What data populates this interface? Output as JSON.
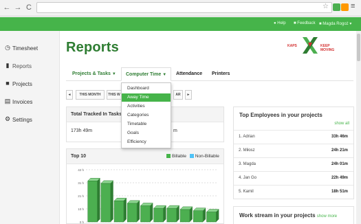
{
  "browser": {
    "back_icon": "back-arrow-icon",
    "forward_icon": "forward-arrow-icon",
    "reload_icon": "reload-icon"
  },
  "header": {
    "help": "Help",
    "feedback": "Feedback",
    "user": "Magda Rogoż"
  },
  "sidebar": {
    "items": [
      {
        "label": "Timesheet",
        "icon": "clock-icon"
      },
      {
        "label": "Reports",
        "icon": "bar-chart-icon"
      },
      {
        "label": "Projects",
        "icon": "briefcase-icon"
      },
      {
        "label": "Invoices",
        "icon": "document-icon"
      },
      {
        "label": "Settings",
        "icon": "gear-icon"
      }
    ]
  },
  "page": {
    "title": "Reports",
    "logo_left": "KAPS",
    "logo_right": "KEEP MOVING"
  },
  "tabs": [
    {
      "label": "Projects & Tasks"
    },
    {
      "label": "Computer Time"
    },
    {
      "label": "Attendance"
    },
    {
      "label": "Printers"
    }
  ],
  "period": {
    "prev": "◄",
    "this_month": "THIS MONTH",
    "this_w": "THIS W",
    "year_suffix": "AR",
    "next": "►"
  },
  "dropdown": {
    "items": [
      "Dashboard",
      "Away Time",
      "Activities",
      "Categories",
      "Timetable",
      "Goals",
      "Efficiency"
    ],
    "active_index": 1
  },
  "tracked": {
    "title": "Total Tracked In Tasks",
    "value": "173h 49m",
    "partial_value": "m"
  },
  "top10": {
    "title": "Top 10",
    "billable": "Billable",
    "non_billable": "Non-Billable"
  },
  "employees": {
    "title": "Top Employees in your projects",
    "show_all": "show all",
    "rows": [
      {
        "name": "1. Adrian",
        "time": "33h 46m"
      },
      {
        "name": "2. Miłosz",
        "time": "24h 21m"
      },
      {
        "name": "3. Magda",
        "time": "24h 01m"
      },
      {
        "name": "4. Jan Go",
        "time": "22h 49m"
      },
      {
        "name": "5. Kamil",
        "time": "18h 51m"
      }
    ]
  },
  "workstream": {
    "title": "Work stream in your projects",
    "show_more": "show more"
  },
  "colors": {
    "brand_green": "#46b44a",
    "title_green": "#2e7d32",
    "non_billable": "#4fc3f7"
  },
  "chart_data": {
    "type": "bar",
    "title": "Top 10",
    "ylabel": "",
    "yticks": [
      "42 h",
      "31 h",
      "21 h",
      "10 h",
      "0 h"
    ],
    "ylim": [
      0,
      42
    ],
    "series": [
      {
        "name": "Billable",
        "values": [
          33,
          31,
          17,
          15,
          13,
          11,
          11,
          10,
          9,
          8
        ]
      },
      {
        "name": "Non-Billable",
        "values": [
          0,
          0,
          0,
          0,
          0,
          0,
          0,
          0,
          0,
          0
        ]
      }
    ]
  }
}
